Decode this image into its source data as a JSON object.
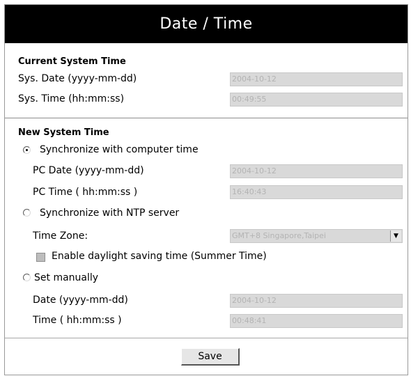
{
  "title": "Date / Time",
  "current": {
    "heading": "Current System Time",
    "sys_date_label": "Sys. Date (yyyy-mm-dd)",
    "sys_date_value": "2004-10-12",
    "sys_time_label": "Sys. Time (hh:mm:ss)",
    "sys_time_value": "00:49:55"
  },
  "new": {
    "heading": "New System Time",
    "sync_computer": {
      "label": "Synchronize with computer time",
      "selected": true,
      "pc_date_label": "PC Date (yyyy-mm-dd)",
      "pc_date_value": "2004-10-12",
      "pc_time_label": "PC Time ( hh:mm:ss )",
      "pc_time_value": "16:40:43"
    },
    "sync_ntp": {
      "label": "Synchronize with NTP server",
      "selected": false,
      "timezone_label": "Time Zone:",
      "timezone_value": "GMT+8 Singapore,Taipei",
      "dst_label": "Enable daylight saving time (Summer Time)",
      "dst_checked": false
    },
    "manual": {
      "label": "Set manually",
      "selected": false,
      "date_label": "Date (yyyy-mm-dd)",
      "date_value": "2004-10-12",
      "time_label": "Time ( hh:mm:ss )",
      "time_value": "00:48:41"
    }
  },
  "save_label": "Save"
}
